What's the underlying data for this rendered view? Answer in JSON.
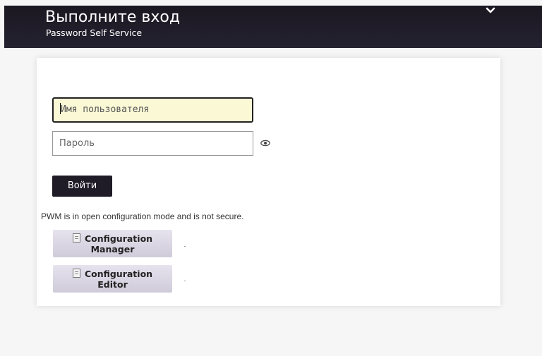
{
  "header": {
    "title": "Выполните вход",
    "subtitle": "Password Self Service",
    "menu_icon": "chevron-down-icon"
  },
  "form": {
    "username_placeholder": "Имя пользователя",
    "password_placeholder": "Пароль",
    "show_password_icon": "eye-icon",
    "login_label": "Войти"
  },
  "config": {
    "notice": "PWM is in open configuration mode and is not secure.",
    "manager_line1": "Configuration",
    "manager_line2": "Manager",
    "editor_line1": "Configuration",
    "editor_line2": "Editor",
    "button_icon": "document-icon"
  },
  "colors": {
    "header_bg": "#1f1b27",
    "username_bg": "#fbf8d6",
    "config_button_bg": "#d9d5e3"
  }
}
